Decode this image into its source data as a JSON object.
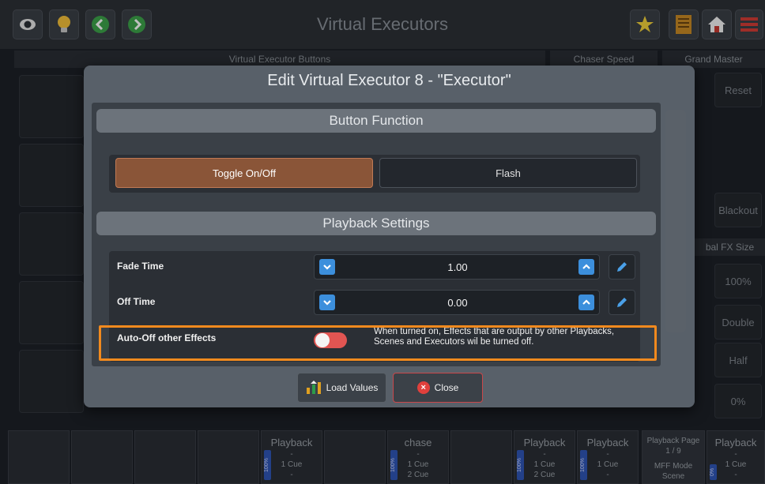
{
  "topbar": {
    "title": "Virtual Executors",
    "left_icons": [
      "eye-icon",
      "bulb-icon",
      "chevron-left-icon",
      "chevron-right-icon"
    ],
    "right_icons": [
      "fx-star-icon",
      "notebook-icon",
      "home-icon",
      "menu-icon"
    ]
  },
  "background": {
    "panel_veb": "Virtual Executor Buttons",
    "panel_chaser": "Chaser Speed",
    "panel_grand": "Grand Master",
    "reset": "Reset",
    "blackout": "Blackout",
    "global_fx": "bal FX Size",
    "fx_100": "100%",
    "double": "Double",
    "half": "Half",
    "fx_0": "0%"
  },
  "playbacks": [
    {
      "title": "Playback",
      "sub1": "-",
      "sub2": "1 Cue",
      "sub3": "-",
      "bar": "100%"
    },
    {
      "title": "chase",
      "sub1": "-",
      "sub2": "1 Cue",
      "sub3": "2 Cue",
      "bar": "100%"
    },
    {
      "title": "Playback",
      "sub1": "-",
      "sub2": "1 Cue",
      "sub3": "2 Cue",
      "bar": "100%"
    },
    {
      "title": "Playback",
      "sub1": "-",
      "sub2": "1 Cue",
      "sub3": "-",
      "bar": "100%"
    },
    {
      "title": "Playback Page",
      "sub1": "1 / 9",
      "sub2": "MFF Mode",
      "sub3": "Scene"
    },
    {
      "title": "Playback",
      "sub1": "-",
      "sub2": "1 Cue",
      "sub3": "-",
      "bar": "0%"
    }
  ],
  "modal": {
    "title": "Edit Virtual Executor 8 - \"Executor\"",
    "section_button_function": "Button Function",
    "toggle_label": "Toggle On/Off",
    "flash_label": "Flash",
    "section_playback": "Playback Settings",
    "fade_time_label": "Fade Time",
    "fade_time_value": "1.00",
    "off_time_label": "Off Time",
    "off_time_value": "0.00",
    "auto_off_label": "Auto-Off other Effects",
    "auto_off_state": "off",
    "auto_off_desc": "When turned on, Effects that are output by other Playbacks, Scenes and Executors wil be turned off.",
    "load_values": "Load Values",
    "close": "Close"
  },
  "colors": {
    "accent_orange": "#f28a1e",
    "toggle_active": "#8a5538",
    "stepper_blue": "#3c8fdc",
    "close_red": "#e0403c"
  }
}
